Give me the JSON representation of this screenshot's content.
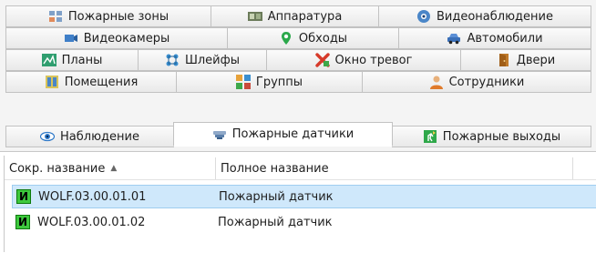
{
  "tab_rows": [
    [
      {
        "label": "Пожарные зоны",
        "icon": "fire-zones-icon"
      },
      {
        "label": "Аппаратура",
        "icon": "equipment-icon"
      },
      {
        "label": "Видеонаблюдение",
        "icon": "video-surveillance-icon"
      }
    ],
    [
      {
        "label": "Видеокамеры",
        "icon": "video-camera-icon"
      },
      {
        "label": "Обходы",
        "icon": "patrol-pin-icon"
      },
      {
        "label": "Автомобили",
        "icon": "car-icon"
      }
    ],
    [
      {
        "label": "Планы",
        "icon": "floor-plan-icon"
      },
      {
        "label": "Шлейфы",
        "icon": "loops-icon"
      },
      {
        "label": "Окно тревог",
        "icon": "alarm-window-icon"
      },
      {
        "label": "Двери",
        "icon": "door-icon"
      }
    ],
    [
      {
        "label": "Помещения",
        "icon": "rooms-icon"
      },
      {
        "label": "Группы",
        "icon": "groups-icon"
      },
      {
        "label": "Сотрудники",
        "icon": "employee-icon"
      }
    ],
    [
      {
        "label": "Наблюдение",
        "icon": "eye-icon"
      },
      {
        "label": "Пожарные датчики",
        "icon": "fire-sensor-icon",
        "active": true
      },
      {
        "label": "Пожарные выходы",
        "icon": "fire-exit-icon"
      }
    ]
  ],
  "table": {
    "columns": [
      {
        "label": "Сокр. название",
        "sort": "ascending"
      },
      {
        "label": "Полное название"
      }
    ],
    "rows": [
      {
        "short": "WOLF.03.00.01.01",
        "full": "Пожарный датчик",
        "status_letter": "И",
        "selected": true
      },
      {
        "short": "WOLF.03.00.01.02",
        "full": "Пожарный датчик",
        "status_letter": "И",
        "selected": false
      }
    ]
  },
  "colors": {
    "selection": "#cfe8fb",
    "status_badge": "#3ec93e"
  }
}
